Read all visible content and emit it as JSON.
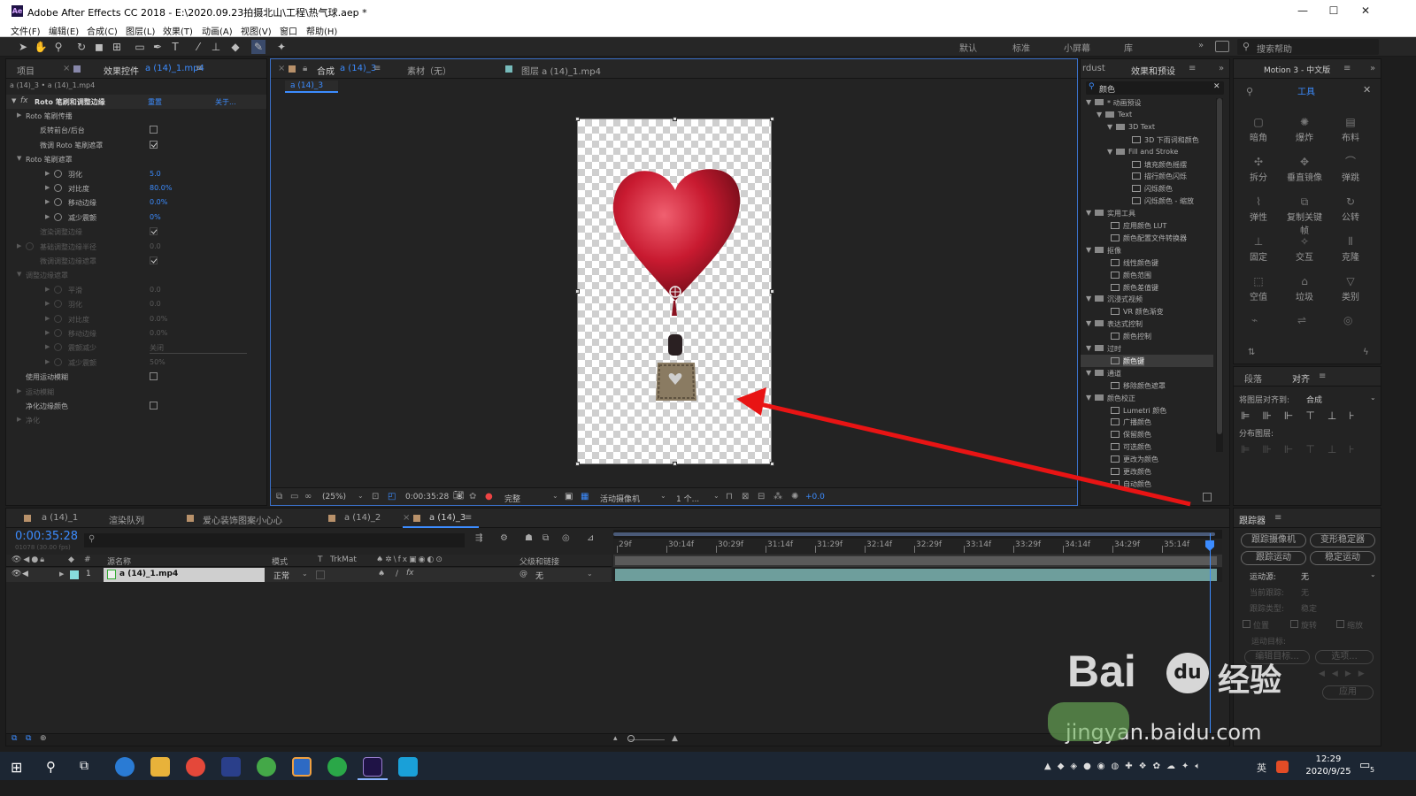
{
  "window": {
    "title": "Adobe After Effects CC 2018 - E:\\2020.09.23拍摄北山\\工程\\热气球.aep *",
    "logo": "Ae"
  },
  "menu": [
    "文件(F)",
    "编辑(E)",
    "合成(C)",
    "图层(L)",
    "效果(T)",
    "动画(A)",
    "视图(V)",
    "窗口",
    "帮助(H)"
  ],
  "workspaces": [
    "默认",
    "标准",
    "小屏幕",
    "库"
  ],
  "search_help_placeholder": "搜索帮助",
  "project_panel": {
    "tab_project": "项目",
    "tab_effects": "效果控件",
    "tab_effects_layer": "a (14)_1.mp4",
    "breadcrumb": "a (14)_3 • a (14)_1.mp4",
    "effect_name": "Roto 笔刷和调整边缘",
    "reset": "重置",
    "about": "关于...",
    "rows": [
      {
        "label": "Roto 笔刷传播",
        "value": "",
        "indent": 1,
        "kind": "group"
      },
      {
        "label": "反转前台/后台",
        "value": "",
        "indent": 2,
        "kind": "check",
        "checked": false
      },
      {
        "label": "微调 Roto 笔刷遮罩",
        "value": "",
        "indent": 2,
        "kind": "check",
        "checked": true
      },
      {
        "label": "Roto 笔刷遮罩",
        "value": "",
        "indent": 1,
        "kind": "open"
      },
      {
        "label": "羽化",
        "value": "5.0",
        "indent": 3,
        "kind": "param"
      },
      {
        "label": "对比度",
        "value": "80.0%",
        "indent": 3,
        "kind": "param"
      },
      {
        "label": "移动边缘",
        "value": "0.0%",
        "indent": 3,
        "kind": "param"
      },
      {
        "label": "减少震颤",
        "value": "0%",
        "indent": 3,
        "kind": "param"
      },
      {
        "label": "渲染调整边缘",
        "value": "",
        "indent": 2,
        "kind": "check",
        "checked": true,
        "dim": true
      },
      {
        "label": "基础调整边缘半径",
        "value": "0.0",
        "indent": 1,
        "kind": "paramgroup",
        "dim": true
      },
      {
        "label": "微调调整边缘遮罩",
        "value": "",
        "indent": 2,
        "kind": "check",
        "checked": true,
        "dim": true
      },
      {
        "label": "调整边缘遮罩",
        "value": "",
        "indent": 1,
        "kind": "open",
        "dim": true
      },
      {
        "label": "平滑",
        "value": "0.0",
        "indent": 3,
        "kind": "param",
        "dim": true
      },
      {
        "label": "羽化",
        "value": "0.0",
        "indent": 3,
        "kind": "param",
        "dim": true
      },
      {
        "label": "对比度",
        "value": "0.0%",
        "indent": 3,
        "kind": "param",
        "dim": true
      },
      {
        "label": "移动边缘",
        "value": "0.0%",
        "indent": 3,
        "kind": "param",
        "dim": true
      },
      {
        "label": "震颤减少",
        "value": "关闭",
        "indent": 3,
        "kind": "select",
        "dim": true
      },
      {
        "label": "减少震颤",
        "value": "50%",
        "indent": 3,
        "kind": "param",
        "dim": true
      },
      {
        "label": "使用运动模糊",
        "value": "",
        "indent": 1,
        "kind": "check",
        "checked": false
      },
      {
        "label": "运动模糊",
        "value": "",
        "indent": 1,
        "kind": "group",
        "dim": true
      },
      {
        "label": "净化边缘颜色",
        "value": "",
        "indent": 1,
        "kind": "check",
        "checked": false
      },
      {
        "label": "净化",
        "value": "",
        "indent": 1,
        "kind": "group",
        "dim": true
      }
    ]
  },
  "comp_panel": {
    "tab_comp": "合成",
    "tab_comp_name": "a (14)_3",
    "tab_footage": "素材（无）",
    "tab_layer": "图层 a (14)_1.mp4",
    "subtab": "a (14)_3",
    "footer": {
      "zoom": "(25%)",
      "timecode": "0:00:35:28",
      "quality": "完整",
      "camera": "活动摄像机",
      "views": "1 个...",
      "exposure": "+0.0"
    }
  },
  "effects_panel": {
    "tab_left": "rdust",
    "tab": "效果和预设",
    "search": "颜色",
    "items": [
      {
        "text": "* 动画预设",
        "level": 0,
        "type": "folder",
        "open": true
      },
      {
        "text": "Text",
        "level": 1,
        "type": "folder",
        "open": true
      },
      {
        "text": "3D Text",
        "level": 2,
        "type": "folder",
        "open": true
      },
      {
        "text": "3D 下雨词和颜色",
        "level": 3,
        "type": "fx"
      },
      {
        "text": "Fill and Stroke",
        "level": 2,
        "type": "folder",
        "open": true
      },
      {
        "text": "填充颜色摇摆",
        "level": 3,
        "type": "fx"
      },
      {
        "text": "描行颜色闪烁",
        "level": 3,
        "type": "fx"
      },
      {
        "text": "闪烁颜色",
        "level": 3,
        "type": "fx"
      },
      {
        "text": "闪烁颜色 - 缩放",
        "level": 3,
        "type": "fx"
      },
      {
        "text": "实用工具",
        "level": 0,
        "type": "folder",
        "open": true
      },
      {
        "text": "应用颜色 LUT",
        "level": 1,
        "type": "fx"
      },
      {
        "text": "颜色配置文件转换器",
        "level": 1,
        "type": "fx"
      },
      {
        "text": "抠像",
        "level": 0,
        "type": "folder",
        "open": true
      },
      {
        "text": "线性颜色键",
        "level": 1,
        "type": "fx"
      },
      {
        "text": "颜色范围",
        "level": 1,
        "type": "fx"
      },
      {
        "text": "颜色差值键",
        "level": 1,
        "type": "fx"
      },
      {
        "text": "沉浸式视频",
        "level": 0,
        "type": "folder",
        "open": true
      },
      {
        "text": "VR 颜色渐变",
        "level": 1,
        "type": "fx"
      },
      {
        "text": "表达式控制",
        "level": 0,
        "type": "folder",
        "open": true
      },
      {
        "text": "颜色控制",
        "level": 1,
        "type": "fx"
      },
      {
        "text": "过时",
        "level": 0,
        "type": "folder",
        "open": true
      },
      {
        "text": "颜色键",
        "level": 1,
        "type": "fx",
        "selected": true
      },
      {
        "text": "通道",
        "level": 0,
        "type": "folder",
        "open": true
      },
      {
        "text": "移除颜色遮罩",
        "level": 1,
        "type": "fx"
      },
      {
        "text": "颜色校正",
        "level": 0,
        "type": "folder",
        "open": true
      },
      {
        "text": "Lumetri 颜色",
        "level": 1,
        "type": "fx"
      },
      {
        "text": "广播颜色",
        "level": 1,
        "type": "fx"
      },
      {
        "text": "保留颜色",
        "level": 1,
        "type": "fx"
      },
      {
        "text": "可选颜色",
        "level": 1,
        "type": "fx"
      },
      {
        "text": "更改为颜色",
        "level": 1,
        "type": "fx"
      },
      {
        "text": "更改颜色",
        "level": 1,
        "type": "fx"
      },
      {
        "text": "自动颜色",
        "level": 1,
        "type": "fx"
      }
    ]
  },
  "motion_panel": {
    "tab": "Motion 3 - 中文版",
    "tools_tab": "工具",
    "tools": [
      [
        "暗角",
        "爆炸",
        "布料"
      ],
      [
        "拆分",
        "垂直镜像",
        "弹跳"
      ],
      [
        "弹性",
        "复制关键帧",
        "公转"
      ],
      [
        "固定",
        "交互",
        "克隆"
      ],
      [
        "空值",
        "垃圾",
        "类别"
      ]
    ],
    "paragraph_tab": "段落",
    "align_tab": "对齐",
    "align_to_label": "将图层对齐到:",
    "align_to_value": "合成",
    "distribute": "分布图层:"
  },
  "timeline": {
    "tabs": [
      "a (14)_1",
      "渲染队列",
      "爱心装饰图案小心心",
      "a (14)_2",
      "a (14)_3"
    ],
    "timecode": "0:00:35:28",
    "frames": "01078 (30.00 fps)",
    "cols": {
      "name": "源名称",
      "mode": "模式",
      "t": "T",
      "trkmat": "TrkMat",
      "parent": "父级和链接"
    },
    "layer": {
      "num": "1",
      "name": "a (14)_1.mp4",
      "mode": "正常",
      "parent": "无"
    },
    "ticks": [
      "29f",
      "30:14f",
      "30:29f",
      "31:14f",
      "31:29f",
      "32:14f",
      "32:29f",
      "33:14f",
      "33:29f",
      "34:14f",
      "34:29f",
      "35:14f"
    ]
  },
  "tracker": {
    "tab": "跟踪器",
    "btn_camera": "跟踪摄像机",
    "btn_warp": "变形稳定器",
    "btn_motion": "跟踪运动",
    "btn_stabilize": "稳定运动",
    "source_label": "运动源:",
    "source_value": "无",
    "current_track": "当前跟踪:",
    "current_value": "无",
    "track_type": "跟踪类型:",
    "track_type_value": "稳定",
    "position": "位置",
    "rotation": "旋转",
    "scale": "缩放",
    "target": "运动目标:",
    "edit_target": "编辑目标...",
    "options": "选项...",
    "apply": "应用"
  },
  "watermark": {
    "brand": "Bai",
    "paw": "du",
    "cn": "经验",
    "url": "jingyan.baidu.com"
  },
  "taskbar": {
    "time": "12:29",
    "date": "2020/9/25",
    "ime": "英",
    "notif": "5"
  }
}
